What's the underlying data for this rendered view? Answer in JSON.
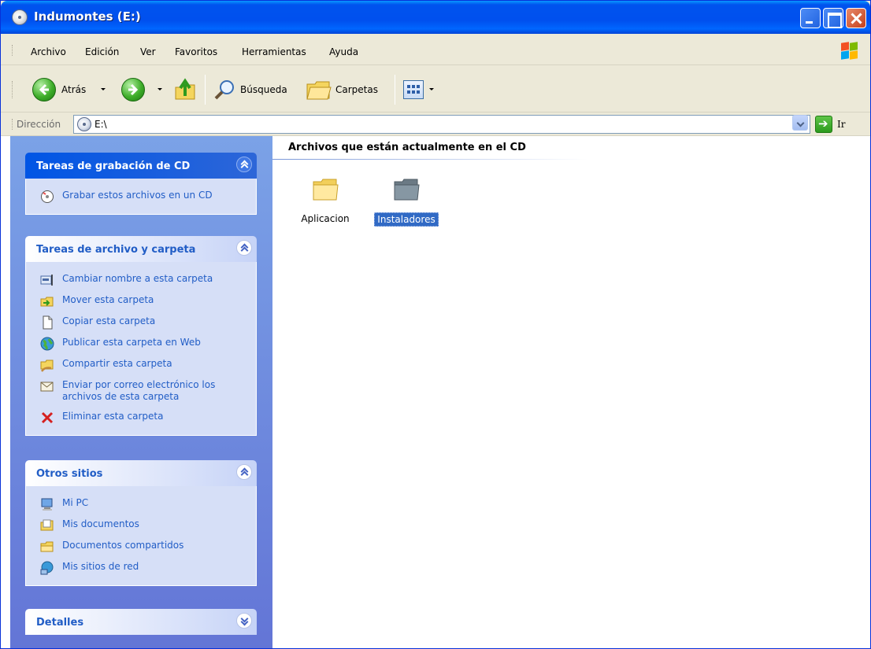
{
  "window": {
    "title": "Indumontes (E:)",
    "colors": {
      "titlebar": "#0053EE",
      "sidebar_top": "#7BA2E7",
      "sidebar_bottom": "#6375D6",
      "link": "#215DC6",
      "selection": "#316AC5"
    }
  },
  "menubar": {
    "items": [
      "Archivo",
      "Edición",
      "Ver",
      "Favoritos",
      "Herramientas",
      "Ayuda"
    ]
  },
  "toolbar": {
    "back_label": "Atrás",
    "search_label": "Búsqueda",
    "folders_label": "Carpetas"
  },
  "address": {
    "label": "Dirección",
    "value": "E:\\",
    "go_label": "Ir"
  },
  "sidebar": {
    "panels": [
      {
        "title": "Tareas de grabación de CD",
        "tasks": [
          {
            "label": "Grabar estos archivos en un CD",
            "icon": "cd-burn-icon"
          }
        ]
      },
      {
        "title": "Tareas de archivo y carpeta",
        "tasks": [
          {
            "label": "Cambiar nombre a esta carpeta",
            "icon": "rename-icon"
          },
          {
            "label": "Mover esta carpeta",
            "icon": "move-folder-icon"
          },
          {
            "label": "Copiar esta carpeta",
            "icon": "copy-icon"
          },
          {
            "label": "Publicar esta carpeta en Web",
            "icon": "globe-icon"
          },
          {
            "label": "Compartir esta carpeta",
            "icon": "share-folder-icon"
          },
          {
            "label": "Enviar por correo electrónico los archivos de esta carpeta",
            "icon": "email-icon"
          },
          {
            "label": "Eliminar esta carpeta",
            "icon": "delete-icon"
          }
        ]
      },
      {
        "title": "Otros sitios",
        "tasks": [
          {
            "label": "Mi PC",
            "icon": "computer-icon"
          },
          {
            "label": "Mis documentos",
            "icon": "documents-folder-icon"
          },
          {
            "label": "Documentos compartidos",
            "icon": "shared-documents-icon"
          },
          {
            "label": "Mis sitios de red",
            "icon": "network-icon"
          }
        ]
      },
      {
        "title": "Detalles"
      }
    ]
  },
  "main": {
    "group_title": "Archivos que están actualmente en el CD",
    "items": [
      {
        "label": "Aplicacion",
        "selected": false
      },
      {
        "label": "Instaladores",
        "selected": true
      }
    ]
  }
}
